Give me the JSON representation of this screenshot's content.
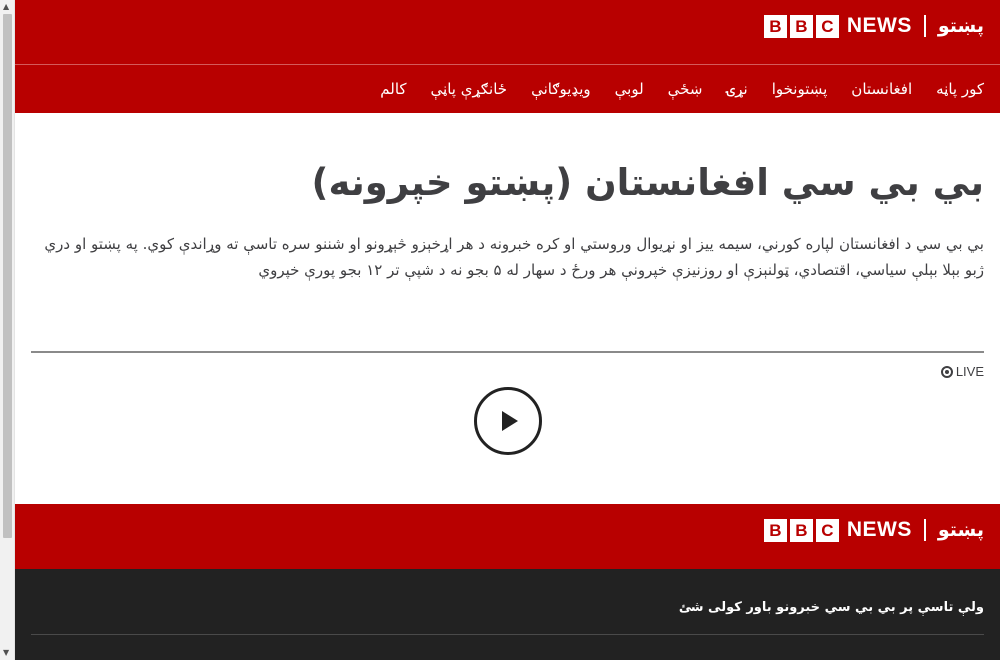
{
  "header": {
    "bbc_letters": [
      "B",
      "B",
      "C"
    ],
    "news_word": "NEWS",
    "service_name": "پښتو"
  },
  "nav": {
    "items": [
      {
        "label": "کور پاڼه"
      },
      {
        "label": "افغانستان"
      },
      {
        "label": "پښتونخوا"
      },
      {
        "label": "نړۍ"
      },
      {
        "label": "ښځې"
      },
      {
        "label": "لوبې"
      },
      {
        "label": "ویډیوګانې"
      },
      {
        "label": "ځانګړې پاڼې"
      },
      {
        "label": "کالم"
      }
    ]
  },
  "main": {
    "title": "بي بي سي افغانستان (پښتو خپرونه)",
    "intro": "بي بي سي د افغانستان لپاره کورني، سيمه ييز او نړيوال وروستي او کره خبرونه د هر اړخېزو څېړونو او شننو سره تاسې ته وړاندې کوي. په پښتو او دري ژبو بېلا بېلې سياسي، اقتصادي، ټولنېزې او روزنيزې خپرونې هر ورځ د سهار له ۵ بجو نه د شپې تر ۱۲ بجو پورې خپروي",
    "live_label": "LIVE"
  },
  "footer": {
    "trust_link": "ولې تاسې پر بي بي سي خبرونو باور کولی شئ"
  },
  "colors": {
    "brand_red": "#b80000",
    "footer_dark": "#222222",
    "text_dark": "#3f3f42"
  },
  "icons": {
    "play": "play-icon",
    "live": "live-indicator-icon"
  }
}
